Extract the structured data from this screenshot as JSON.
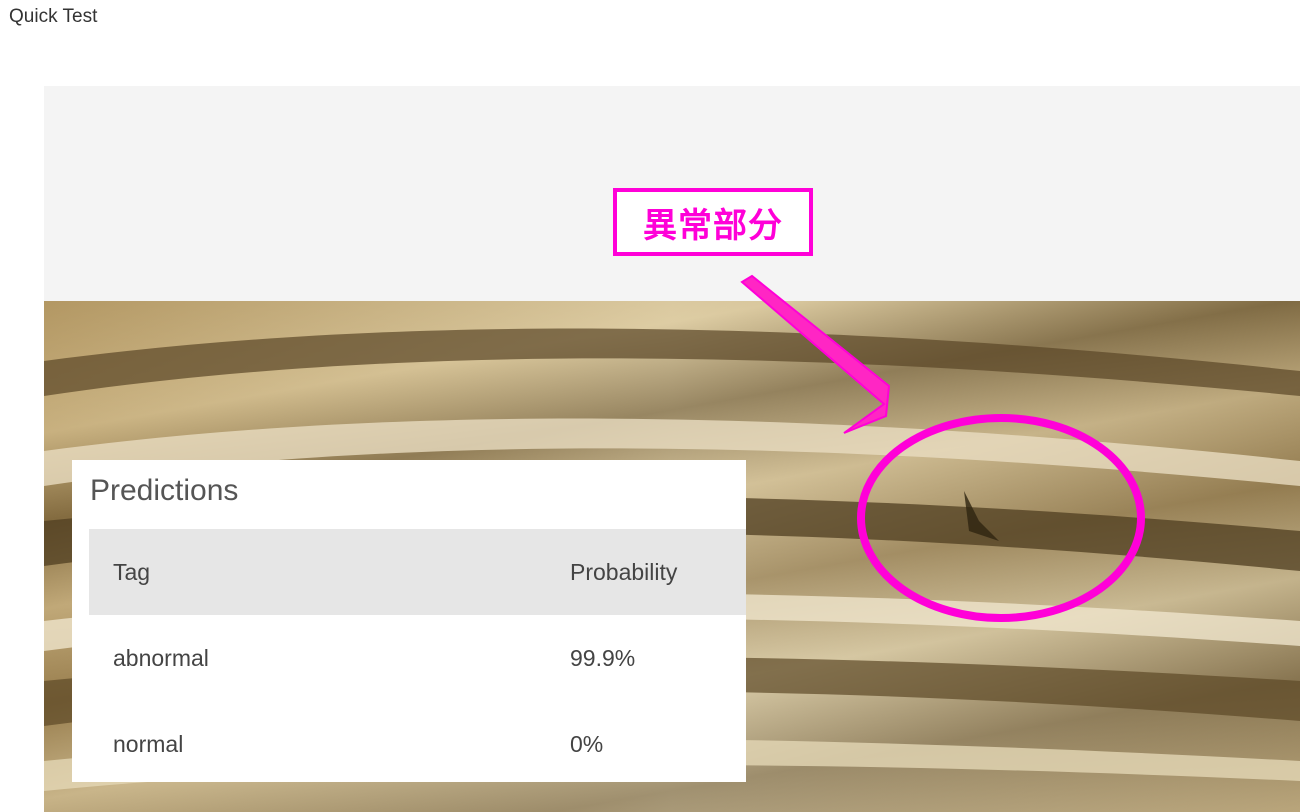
{
  "page": {
    "title": "Quick Test"
  },
  "annotation": {
    "label": "異常部分",
    "color": "#ff00d8"
  },
  "predictions": {
    "title": "Predictions",
    "columns": {
      "tag": "Tag",
      "probability": "Probability"
    },
    "rows": [
      {
        "tag": "abnormal",
        "probability": "99.9%"
      },
      {
        "tag": "normal",
        "probability": "0%"
      }
    ]
  }
}
